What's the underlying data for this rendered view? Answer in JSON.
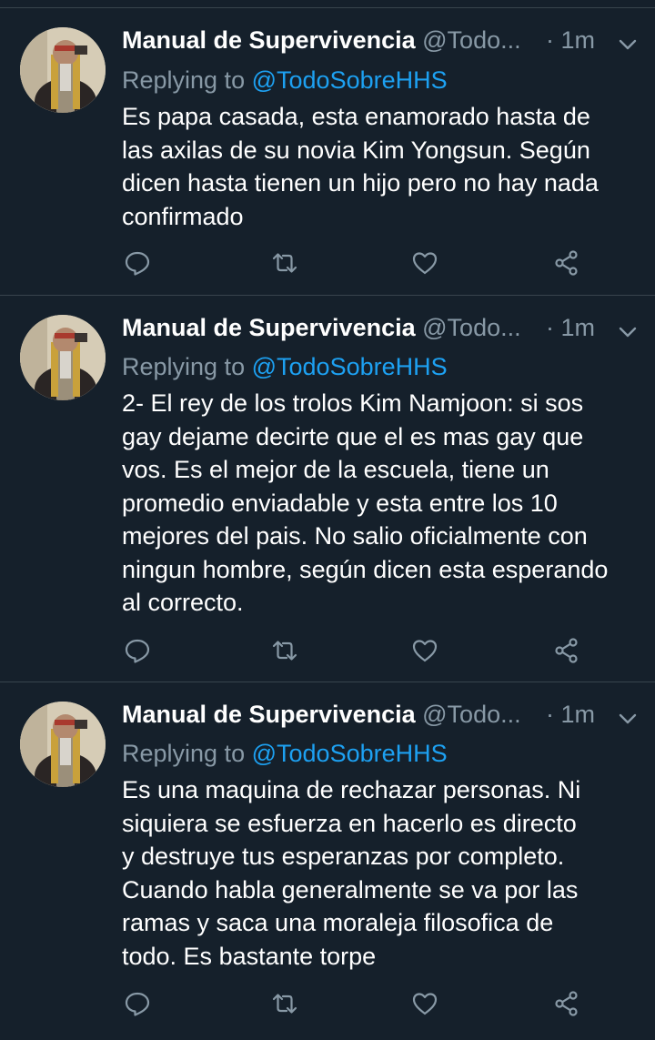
{
  "tweets": [
    {
      "author_name": "Manual de Supervivencia",
      "author_handle": "@Todo...",
      "time": "· 1m",
      "reply_prefix": "Replying to",
      "reply_handle": "@TodoSobreHHS",
      "text_lines": [
        "Es papa casada, esta enamorado hasta de",
        "las axilas de su novia Kim Yongsun. Según",
        "dicen hasta tienen un hijo pero no hay nada",
        "confirmado"
      ]
    },
    {
      "author_name": "Manual de Supervivencia",
      "author_handle": "@Todo...",
      "time": "· 1m",
      "reply_prefix": "Replying to",
      "reply_handle": "@TodoSobreHHS",
      "text_lines": [
        "2- El rey de los trolos Kim Namjoon: si sos",
        "gay dejame decirte que el es mas gay que",
        "vos. Es el mejor de la escuela, tiene un",
        "promedio enviadable y esta entre los 10",
        "mejores del pais. No salio oficialmente con",
        "ningun hombre, según dicen esta esperando",
        "al correcto."
      ]
    },
    {
      "author_name": "Manual de Supervivencia",
      "author_handle": "@Todo...",
      "time": "· 1m",
      "reply_prefix": "Replying to",
      "reply_handle": "@TodoSobreHHS",
      "text_lines": [
        "Es una maquina de rechazar personas. Ni",
        "siquiera se esfuerza en hacerlo es directo",
        "y destruye tus esperanzas por completo.",
        "Cuando habla generalmente se va por las",
        "ramas y saca una moraleja filosofica de",
        "todo. Es bastante torpe"
      ]
    }
  ],
  "colors": {
    "background": "#15202b",
    "divider": "#38444d",
    "secondary_text": "#8899a6",
    "link": "#1da1f2",
    "icon": "#8899a6"
  },
  "icons": [
    "reply-icon",
    "retweet-icon",
    "like-icon",
    "share-icon",
    "chevron-down-icon"
  ]
}
